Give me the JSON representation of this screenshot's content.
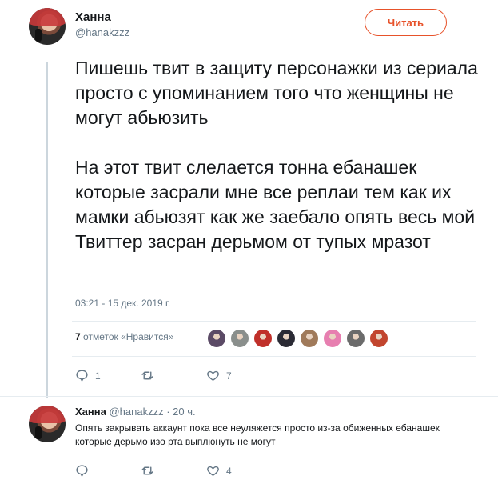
{
  "tweet": {
    "author_name": "Ханна",
    "author_handle": "@hanakzzz",
    "follow_label": "Читать",
    "text": "Пишешь твит в защиту персонажки из сериала просто с упоминанием того что женщины не могут абьюзить\n\nНа этот твит слелается тонна ебанашек которые засрали мне все реплаи тем как их мамки абьюзят как же заебало опять весь мой Твиттер засран дерьмом от тупых мразот",
    "timestamp": "03:21 - 15 дек. 2019 г.",
    "likes_count": "7",
    "likes_label": "отметок «Нравится»",
    "liker_colors": [
      "#5b4a66",
      "#8a8f8c",
      "#c0302a",
      "#2b2b35",
      "#a07a5a",
      "#e77fb0",
      "#6b6b6b",
      "#c2452e"
    ],
    "replies_count": "1",
    "retweets_count": "",
    "like_count_action": "7"
  },
  "reply": {
    "author_name": "Ханна",
    "author_handle": "@hanakzzz",
    "time": "· 20 ч.",
    "text": "Опять закрывать аккаунт пока все неуляжется просто из-за обиженных ебанашек которые дерьмо изо рта выплюнуть не могут",
    "replies_count": "",
    "retweets_count": "",
    "likes_count": "4"
  },
  "icons": [
    "reply-icon",
    "retweet-icon",
    "heart-icon"
  ],
  "colors": {
    "accent": "#e7522a",
    "muted": "#657786",
    "text": "#14171a"
  }
}
